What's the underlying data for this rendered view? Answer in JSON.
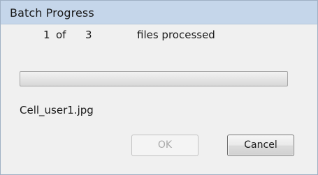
{
  "dialog": {
    "title": "Batch Progress"
  },
  "progress": {
    "current": "1",
    "of_label": "of",
    "total": "3",
    "suffix": "files processed",
    "fraction": 0
  },
  "file": {
    "name": "Cell_user1.jpg"
  },
  "buttons": {
    "ok_label": "OK",
    "ok_enabled": false,
    "cancel_label": "Cancel"
  },
  "colors": {
    "titlebar": "#c5d6ea",
    "frame": "#9fb0c4",
    "client": "#f0f0f0"
  }
}
